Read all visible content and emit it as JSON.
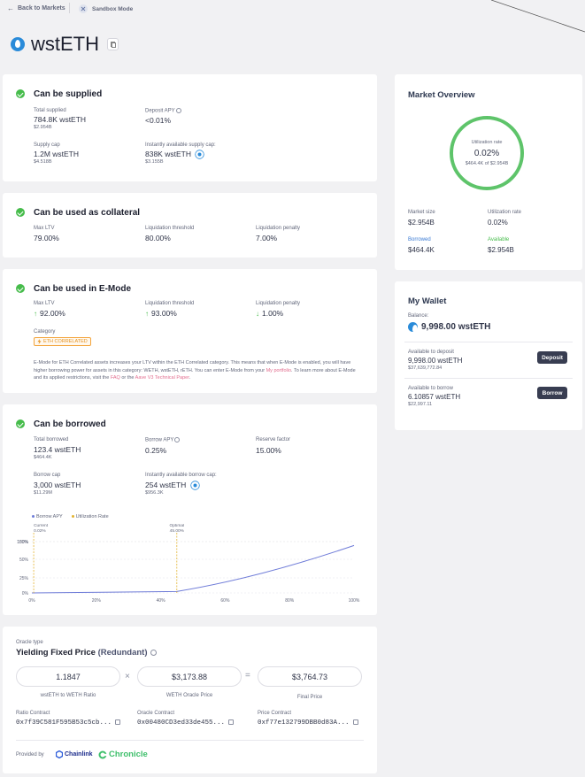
{
  "nav": {
    "back_label": "Back to Markets",
    "sandbox_label": "Sandbox Mode"
  },
  "asset": {
    "name": "wstETH"
  },
  "supply": {
    "title": "Can be supplied",
    "total_supplied_label": "Total supplied",
    "total_supplied_value": "784.8K wstETH",
    "total_supplied_usd": "$2.954B",
    "deposit_apy_label": "Deposit APY",
    "deposit_apy_value": "<0.01%",
    "supply_cap_label": "Supply cap",
    "supply_cap_value": "1.2M wstETH",
    "supply_cap_usd": "$4.518B",
    "available_cap_label": "Instantly available supply cap:",
    "available_cap_value": "838K wstETH",
    "available_cap_usd": "$3.155B"
  },
  "collateral": {
    "title": "Can be used as collateral",
    "max_ltv_label": "Max LTV",
    "max_ltv_value": "79.00%",
    "liq_threshold_label": "Liquidation threshold",
    "liq_threshold_value": "80.00%",
    "liq_penalty_label": "Liquidation penalty",
    "liq_penalty_value": "7.00%"
  },
  "emode": {
    "title": "Can be used in E-Mode",
    "max_ltv_label": "Max LTV",
    "max_ltv_value": "92.00%",
    "liq_threshold_label": "Liquidation threshold",
    "liq_threshold_value": "93.00%",
    "liq_penalty_label": "Liquidation penalty",
    "liq_penalty_value": "1.00%",
    "category_label": "Category",
    "category_value": "ETH CORRELATED",
    "description_1": "E-Mode for ETH Correlated assets increases your LTV within the ETH Correlated category. This means that when E-Mode is enabled, you will have higher borrowing power for assets in this category: WETH, wstETH, rETH. You can enter E-Mode from your ",
    "portfolio_link": "My portfolio",
    "description_2": ". To learn more about E-Mode and its applied restrictions, visit the ",
    "faq_link": "FAQ",
    "description_3": " or the ",
    "paper_link": "Aave V3 Technical Paper",
    "description_4": "."
  },
  "borrow": {
    "title": "Can be borrowed",
    "total_borrowed_label": "Total borrowed",
    "total_borrowed_value": "123.4 wstETH",
    "total_borrowed_usd": "$464.4K",
    "borrow_apy_label": "Borrow APY",
    "borrow_apy_value": "0.25%",
    "reserve_factor_label": "Reserve factor",
    "reserve_factor_value": "15.00%",
    "borrow_cap_label": "Borrow cap",
    "borrow_cap_value": "3,000 wstETH",
    "borrow_cap_usd": "$11.29M",
    "available_cap_label": "Instantly available borrow cap:",
    "available_cap_value": "254 wstETH",
    "available_cap_usd": "$956.3K"
  },
  "chart_data": {
    "type": "line",
    "series": [
      {
        "name": "Borrow APY",
        "x": [
          0,
          45,
          60,
          80,
          100
        ],
        "values": [
          0,
          4,
          35,
          77,
          130
        ]
      }
    ],
    "legend": [
      "Borrow APY",
      "Utilization Rate"
    ],
    "x_ticks": [
      "0%",
      "20%",
      "40%",
      "60%",
      "80%",
      "100%"
    ],
    "y_ticks": [
      "0%",
      "25%",
      "50%",
      "100%",
      "150%"
    ],
    "markers": [
      {
        "label": "Current",
        "value_label": "0.02%",
        "x": 0.02
      },
      {
        "label": "Optimal",
        "value_label": "45.00%",
        "x": 45
      }
    ],
    "xlim": [
      0,
      100
    ],
    "ylim": [
      0,
      160
    ],
    "colors": {
      "line": "#6f7cd8",
      "marker": "#e3b431",
      "grid": "#e5e5ea"
    }
  },
  "oracle": {
    "type_label": "Oracle type",
    "title": "Yielding Fixed Price",
    "title_suffix": "(Redundant)",
    "ratio_value": "1.1847",
    "ratio_label": "wstETH to WETH Ratio",
    "weth_value": "$3,173.88",
    "weth_label": "WETH Oracle Price",
    "final_value": "$3,764.73",
    "final_label": "Final Price",
    "times": "×",
    "equals": "=",
    "ratio_contract_label": "Ratio Contract",
    "ratio_contract": "0x7f39C581F595B53c5cb...",
    "oracle_contract_label": "Oracle Contract",
    "oracle_contract": "0x00480CD3ed33de455...",
    "price_contract_label": "Price Contract",
    "price_contract": "0xf77e132799DBB0d83A...",
    "provided_label": "Provided by",
    "provider_1": "Chainlink",
    "provider_2": "Chronicle"
  },
  "overview": {
    "title": "Market Overview",
    "gauge_label": "Utilization rate",
    "gauge_value": "0.02%",
    "gauge_sub": "$464.4K of $2.954B",
    "utilization_fraction": 0.0002,
    "market_size_label": "Market size",
    "market_size_value": "$2.954B",
    "utilization_label": "Utilization rate",
    "utilization_value": "0.02%",
    "borrowed_label": "Borrowed",
    "borrowed_value": "$464.4K",
    "available_label": "Available",
    "available_value": "$2.954B"
  },
  "wallet": {
    "title": "My Wallet",
    "balance_label": "Balance:",
    "balance_value": "9,998.00 wstETH",
    "deposit_label": "Available to deposit",
    "deposit_value": "9,998.00 wstETH",
    "deposit_usd": "$37,639,772.84",
    "deposit_button": "Deposit",
    "borrow_label": "Available to borrow",
    "borrow_value": "6.10857 wstETH",
    "borrow_usd": "$22,997.11",
    "borrow_button": "Borrow"
  }
}
